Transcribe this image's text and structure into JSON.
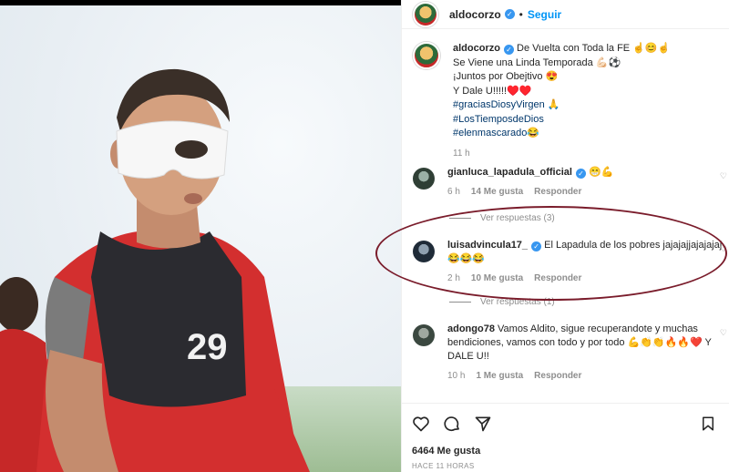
{
  "post": {
    "username": "aldocorzo",
    "follow_label": "Seguir",
    "caption_lines": [
      "De Vuelta con Toda la FE ☝️😊☝️",
      "Se Viene una Linda Temporada 💪🏻⚽",
      "¡Juntos por Obejtivo 😍",
      "Y Dale U!!!!!♥️♥️"
    ],
    "hashtags": [
      "#graciasDiosyVirgen 🙏",
      "#LosTiemposdeDios",
      "#elenmascarado😂"
    ],
    "caption_time": "11 h",
    "likes": "6464 Me gusta",
    "posted_ago": "HACE 11 HORAS"
  },
  "photo": {
    "jersey_number": "29"
  },
  "comments": [
    {
      "username": "gianluca_lapadula_official",
      "verified": true,
      "text": "😁💪",
      "time": "6 h",
      "likes": "14 Me gusta",
      "reply_label": "Responder",
      "replies": "Ver respuestas (3)"
    },
    {
      "username": "luisadvincula17_",
      "verified": true,
      "text": "El Lapadula de los pobres jajajajjajajajaj 😂😂😂",
      "time": "2 h",
      "likes": "10 Me gusta",
      "reply_label": "Responder",
      "replies": "Ver respuestas (1)"
    },
    {
      "username": "adongo78",
      "verified": false,
      "text": "Vamos Aldito, sigue recuperandote y muchas bendiciones, vamos con todo y por todo 💪👏👏🔥🔥❤️ Y DALE U!!",
      "time": "10 h",
      "likes": "1 Me gusta",
      "reply_label": "Responder"
    }
  ],
  "icons": {
    "heart": "heart-icon",
    "comment": "comment-icon",
    "share": "share-icon",
    "bookmark": "bookmark-icon",
    "verified": "verified-badge-icon"
  },
  "colors": {
    "accent": "#0095f6",
    "verified": "#3897f0",
    "highlight_ring": "#7a1c2b",
    "jersey_red": "#d32f2f",
    "mask_white": "#f7f7f7"
  }
}
